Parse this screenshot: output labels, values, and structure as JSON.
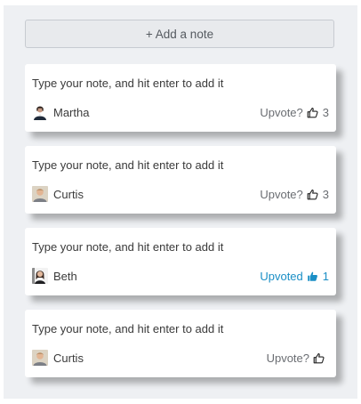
{
  "add_note_label": "+ Add a note",
  "notes": [
    {
      "text": "Type your note, and hit enter to add it",
      "author": "Martha",
      "avatar": "martha-avatar",
      "vote_label": "Upvote?",
      "vote_count": "3",
      "upvoted": false,
      "thumb_icon": "thumbs-up-outline-icon"
    },
    {
      "text": "Type your note, and hit enter to add it",
      "author": "Curtis",
      "avatar": "curtis-avatar",
      "vote_label": "Upvote?",
      "vote_count": "3",
      "upvoted": false,
      "thumb_icon": "thumbs-up-outline-icon"
    },
    {
      "text": "Type your note, and hit enter to add it",
      "author": "Beth",
      "avatar": "beth-avatar",
      "vote_label": "Upvoted",
      "vote_count": "1",
      "upvoted": true,
      "thumb_icon": "thumbs-up-filled-icon"
    },
    {
      "text": "Type your note, and hit enter to add it",
      "author": "Curtis",
      "avatar": "curtis-avatar",
      "vote_label": "Upvote?",
      "vote_count": "",
      "upvoted": false,
      "thumb_icon": "thumbs-up-outline-icon"
    }
  ],
  "colors": {
    "upvoted": "#1b8fc6",
    "vote": "#6a6d72",
    "panel": "#eef0f3"
  }
}
